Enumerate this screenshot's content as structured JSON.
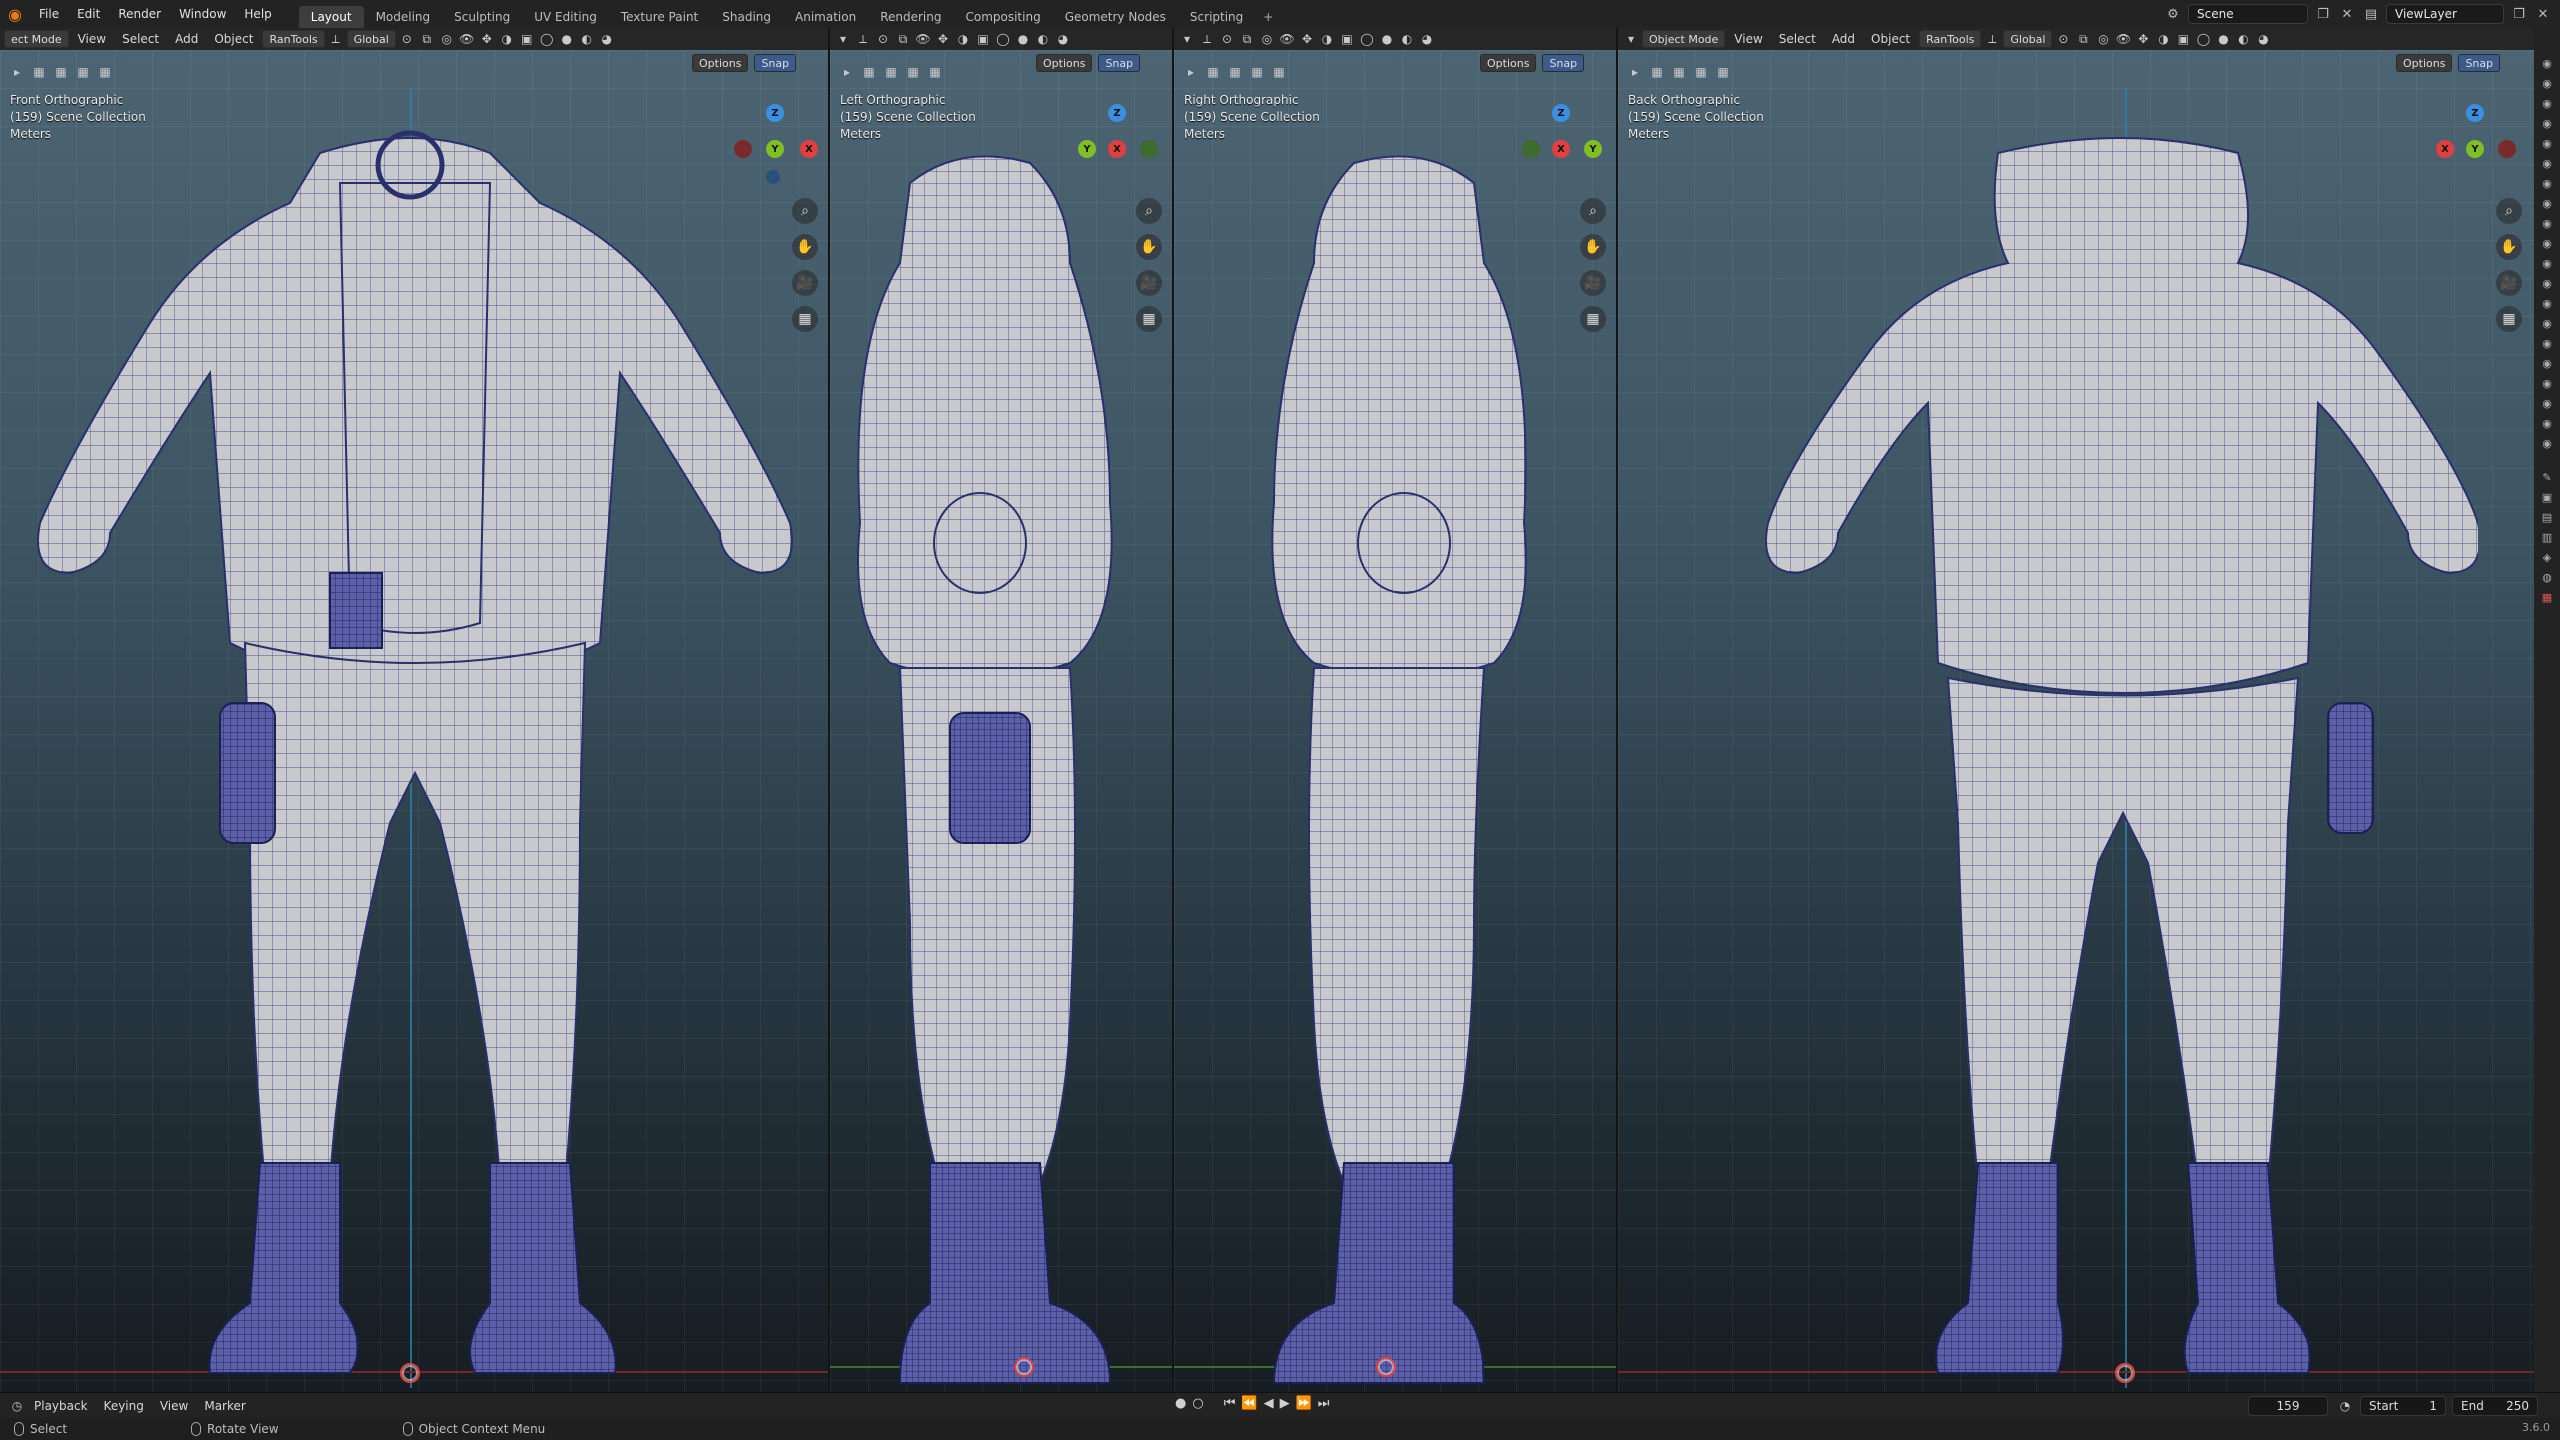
{
  "app": {
    "menu": [
      "File",
      "Edit",
      "Render",
      "Window",
      "Help"
    ],
    "workspaces": [
      "Layout",
      "Modeling",
      "Sculpting",
      "UV Editing",
      "Texture Paint",
      "Shading",
      "Animation",
      "Rendering",
      "Compositing",
      "Geometry Nodes",
      "Scripting"
    ],
    "active_workspace": "Layout",
    "add_workspace": "+",
    "scene": "Scene",
    "view_layer": "ViewLayer"
  },
  "viewports": [
    {
      "mode": "ect Mode",
      "menus": [
        "View",
        "Select",
        "Add",
        "Object",
        "RanTools"
      ],
      "orientation": "Global",
      "view_name": "Front Orthographic",
      "collection": "(159) Scene Collection",
      "units": "Meters",
      "options": "Options",
      "snap": "Snap",
      "gizmo": [
        "Z",
        "Y",
        "X"
      ]
    },
    {
      "mode": "",
      "menus": [],
      "orientation": "",
      "view_name": "Left Orthographic",
      "collection": "(159) Scene Collection",
      "units": "Meters",
      "options": "Options",
      "snap": "Snap",
      "gizmo": [
        "Z",
        "Y",
        "X"
      ]
    },
    {
      "mode": "",
      "menus": [],
      "orientation": "",
      "view_name": "Right Orthographic",
      "collection": "(159) Scene Collection",
      "units": "Meters",
      "options": "Options",
      "snap": "Snap",
      "gizmo": [
        "Z",
        "X",
        "Y"
      ]
    },
    {
      "mode": "Object Mode",
      "menus": [
        "View",
        "Select",
        "Add",
        "Object",
        "RanTools"
      ],
      "orientation": "Global",
      "view_name": "Back Orthographic",
      "collection": "(159) Scene Collection",
      "units": "Meters",
      "options": "Options",
      "snap": "Snap",
      "gizmo": [
        "Z",
        "X",
        "Y"
      ]
    }
  ],
  "timeline": {
    "menus": [
      "Playback",
      "Keying",
      "View",
      "Marker"
    ],
    "current_frame": "159",
    "start_label": "Start",
    "start": "1",
    "end_label": "End",
    "end": "250"
  },
  "status": {
    "items": [
      "Select",
      "Rotate View",
      "Object Context Menu"
    ],
    "version": "3.6.0"
  },
  "colors": {
    "accent_x": "#e0403f",
    "accent_y": "#7fbf26",
    "accent_z": "#3b8fe0",
    "active_tab": "#3d3d3d",
    "mesh_wire": "#2a2f6e"
  }
}
